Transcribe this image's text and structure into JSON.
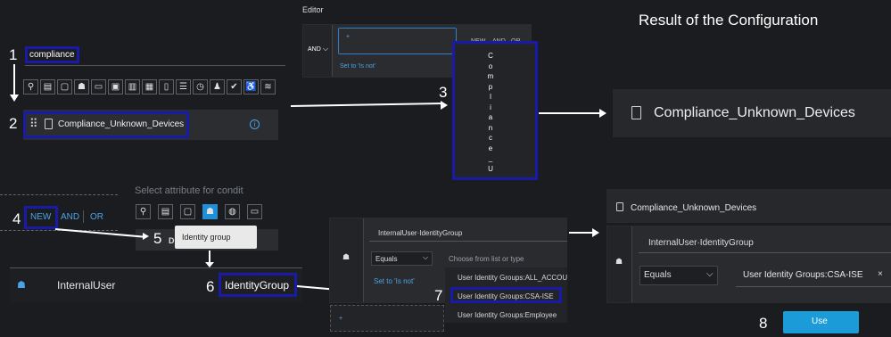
{
  "steps": [
    "1",
    "2",
    "3",
    "4",
    "5",
    "6",
    "7",
    "8"
  ],
  "search": {
    "value": "compliance"
  },
  "icon_bar_left": [
    "location-icon",
    "card-icon",
    "square-icon",
    "group-icon",
    "monitor-icon",
    "desktop-icon",
    "window-icon",
    "cards-icon",
    "tablet-icon",
    "list-icon",
    "clock-icon",
    "person-icon",
    "check-circle-icon",
    "accessibility-icon",
    "wifi-icon"
  ],
  "condition_item": {
    "label": "Compliance_Unknown_Devices"
  },
  "editor": {
    "title": "Editor",
    "and_label": "AND",
    "set_to": "Set to 'Is not'",
    "new_label": "NEW",
    "and_btn": "AND",
    "or_btn": "OR",
    "vertical_text": [
      "C",
      "o",
      "m",
      "p",
      "l",
      "i",
      "a",
      "n",
      "c",
      "e",
      "_",
      "U"
    ]
  },
  "result": {
    "heading": "Result of the Configuration",
    "condition_label": "Compliance_Unknown_Devices"
  },
  "attr": {
    "select_label": "Select attribute for condit",
    "new": "NEW",
    "and": "AND",
    "or": "OR",
    "tooltip": "Identity group",
    "partial_label": "D"
  },
  "internal_user": {
    "label": "InternalUser",
    "identity_group": "IdentityGroup"
  },
  "mid_panel": {
    "attribute": "InternalUser·IdentityGroup",
    "operator": "Equals",
    "choose": "Choose from list or type",
    "set_to": "Set to 'Is not'",
    "options": [
      "User Identity Groups:ALL_ACCOU",
      "User Identity Groups:CSA-ISE",
      "User Identity Groups:Employee"
    ]
  },
  "final": {
    "condition_label": "Compliance_Unknown_Devices",
    "attribute": "InternalUser·IdentityGroup",
    "operator": "Equals",
    "value": "User Identity Groups:CSA-ISE",
    "clear": "×"
  },
  "use_button": {
    "label": "Use"
  }
}
